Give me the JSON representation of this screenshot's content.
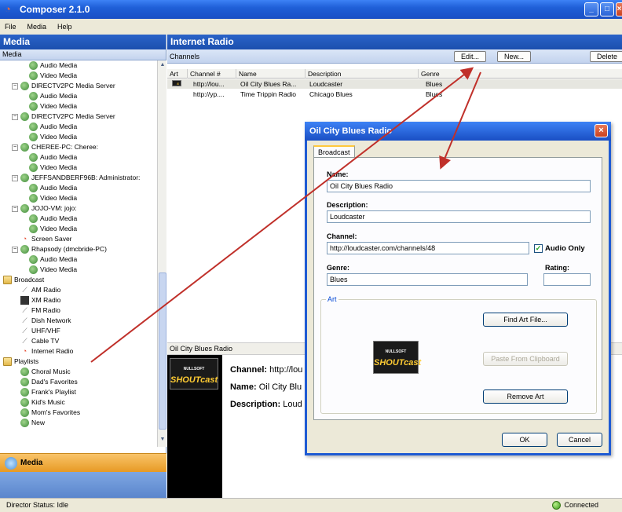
{
  "window": {
    "title": "Composer 2.1.0"
  },
  "menu": [
    "File",
    "Media",
    "Help"
  ],
  "left": {
    "header": "Media",
    "subheader": "Media",
    "tree": [
      {
        "label": "Audio Media",
        "indent": 3,
        "icon": "media"
      },
      {
        "label": "Video Media",
        "indent": 3,
        "icon": "media"
      },
      {
        "label": "DIRECTV2PC Media Server",
        "indent": 1,
        "icon": "media",
        "exp": "−"
      },
      {
        "label": "Audio Media",
        "indent": 3,
        "icon": "media"
      },
      {
        "label": "Video Media",
        "indent": 3,
        "icon": "media"
      },
      {
        "label": "DIRECTV2PC Media Server",
        "indent": 1,
        "icon": "media",
        "exp": "−"
      },
      {
        "label": "Audio Media",
        "indent": 3,
        "icon": "media"
      },
      {
        "label": "Video Media",
        "indent": 3,
        "icon": "media"
      },
      {
        "label": "CHEREE-PC: Cheree:",
        "indent": 1,
        "icon": "media",
        "exp": "−"
      },
      {
        "label": "Audio Media",
        "indent": 3,
        "icon": "media"
      },
      {
        "label": "Video Media",
        "indent": 3,
        "icon": "media"
      },
      {
        "label": "JEFFSANDBERF96B: Administrator:",
        "indent": 1,
        "icon": "media",
        "exp": "−"
      },
      {
        "label": "Audio Media",
        "indent": 3,
        "icon": "media"
      },
      {
        "label": "Video Media",
        "indent": 3,
        "icon": "media"
      },
      {
        "label": "JOJO-VM: jojo:",
        "indent": 1,
        "icon": "media",
        "exp": "−"
      },
      {
        "label": "Audio Media",
        "indent": 3,
        "icon": "media"
      },
      {
        "label": "Video Media",
        "indent": 3,
        "icon": "media"
      },
      {
        "label": "Screen Saver",
        "indent": 2,
        "icon": "red"
      },
      {
        "label": "Rhapsody (dmcbride-PC)",
        "indent": 1,
        "icon": "media",
        "exp": "−"
      },
      {
        "label": "Audio Media",
        "indent": 3,
        "icon": "media"
      },
      {
        "label": "Video Media",
        "indent": 3,
        "icon": "media"
      },
      {
        "label": "Broadcast",
        "indent": 0,
        "icon": "folder"
      },
      {
        "label": "AM Radio",
        "indent": 2,
        "icon": "gray"
      },
      {
        "label": "XM Radio",
        "indent": 2,
        "icon": "dark"
      },
      {
        "label": "FM Radio",
        "indent": 2,
        "icon": "gray"
      },
      {
        "label": "Dish Network",
        "indent": 2,
        "icon": "gray"
      },
      {
        "label": "UHF/VHF",
        "indent": 2,
        "icon": "gray"
      },
      {
        "label": "Cable TV",
        "indent": 2,
        "icon": "gray"
      },
      {
        "label": "Internet Radio",
        "indent": 2,
        "icon": "red"
      },
      {
        "label": "Playlists",
        "indent": 0,
        "icon": "folder"
      },
      {
        "label": "Choral Music",
        "indent": 2,
        "icon": "media"
      },
      {
        "label": "Dad's Favorites",
        "indent": 2,
        "icon": "media"
      },
      {
        "label": "Frank's Playlist",
        "indent": 2,
        "icon": "media"
      },
      {
        "label": "Kid's Music",
        "indent": 2,
        "icon": "media"
      },
      {
        "label": "Mom's Favorites",
        "indent": 2,
        "icon": "media"
      },
      {
        "label": "New",
        "indent": 2,
        "icon": "media"
      }
    ],
    "media_button": "Media"
  },
  "right": {
    "header": "Internet Radio",
    "channels_label": "Channels",
    "buttons": {
      "edit": "Edit...",
      "new": "New...",
      "delete": "Delete"
    },
    "columns": [
      "Art",
      "Channel #",
      "Name",
      "Description",
      "Genre"
    ],
    "rows": [
      [
        "http://lou...",
        "Oil City Blues Ra...",
        "Loudcaster",
        "Blues"
      ],
      [
        "http://yp....",
        "Time Trippin Radio",
        "Chicago Blues",
        "Blues"
      ]
    ],
    "preview": {
      "title": "Oil City Blues Radio",
      "channel_label": "Channel:",
      "channel_value": "http://lou",
      "name_label": "Name:",
      "name_value": "Oil City Blu",
      "desc_label": "Description:",
      "desc_value": "Loud"
    }
  },
  "dialog": {
    "title": "Oil City Blues Radio",
    "tab": "Broadcast",
    "name_label": "Name:",
    "name_value": "Oil City Blues Radio",
    "desc_label": "Description:",
    "desc_value": "Loudcaster",
    "channel_label": "Channel:",
    "channel_value": "http://loudcaster.com/channels/48",
    "audio_only_label": "Audio Only",
    "audio_only_checked": true,
    "genre_label": "Genre:",
    "genre_value": "Blues",
    "rating_label": "Rating:",
    "rating_value": "",
    "art_legend": "Art",
    "find_art": "Find Art File...",
    "paste_clipboard": "Paste From Clipboard",
    "remove_art": "Remove Art",
    "ok": "OK",
    "cancel": "Cancel"
  },
  "logo": {
    "brand": "SHOUTcast",
    "maker": "NULLSOFT"
  },
  "status": {
    "text": "Director Status: Idle",
    "connection": "Connected"
  },
  "colors": {
    "title_blue": "#1f5fd8",
    "annotation_red": "#c0302a",
    "media_orange": "#e79a24"
  }
}
